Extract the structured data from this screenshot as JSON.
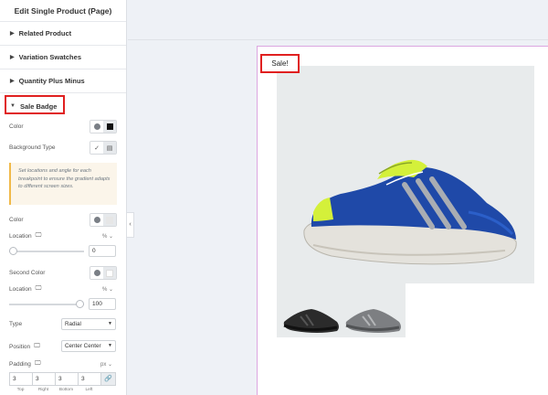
{
  "panel": {
    "title": "Edit Single Product (Page)",
    "sections": {
      "related": "Related Product",
      "swatches": "Variation Swatches",
      "quantity": "Quantity Plus Minus",
      "sale_badge": "Sale Badge"
    }
  },
  "sale_badge_settings": {
    "color_label": "Color",
    "bg_type_label": "Background Type",
    "note": "Set locations and angle for each breakpoint to ensure the gradient adapts to different screen sizes.",
    "color2_label": "Color",
    "location_label": "Location",
    "location_unit": "% ⌄",
    "location_value": "0",
    "location_fraction": 0.0,
    "second_color_label": "Second Color",
    "location2_label": "Location",
    "location2_unit": "% ⌄",
    "location2_value": "100",
    "location2_fraction": 1.0,
    "type_label": "Type",
    "type_value": "Radial",
    "position_label": "Position",
    "position_value": "Center Center",
    "padding_label": "Padding",
    "padding_unit": "px ⌄",
    "padding_values": [
      "3",
      "3",
      "3",
      "3"
    ],
    "padding_sides": [
      "Top",
      "Right",
      "Bottom",
      "Left"
    ]
  },
  "preview": {
    "sale_text": "Sale!"
  },
  "colors": {
    "highlight": "#e02020",
    "note_border": "#f0b949",
    "page_border": "#dca6e0"
  }
}
